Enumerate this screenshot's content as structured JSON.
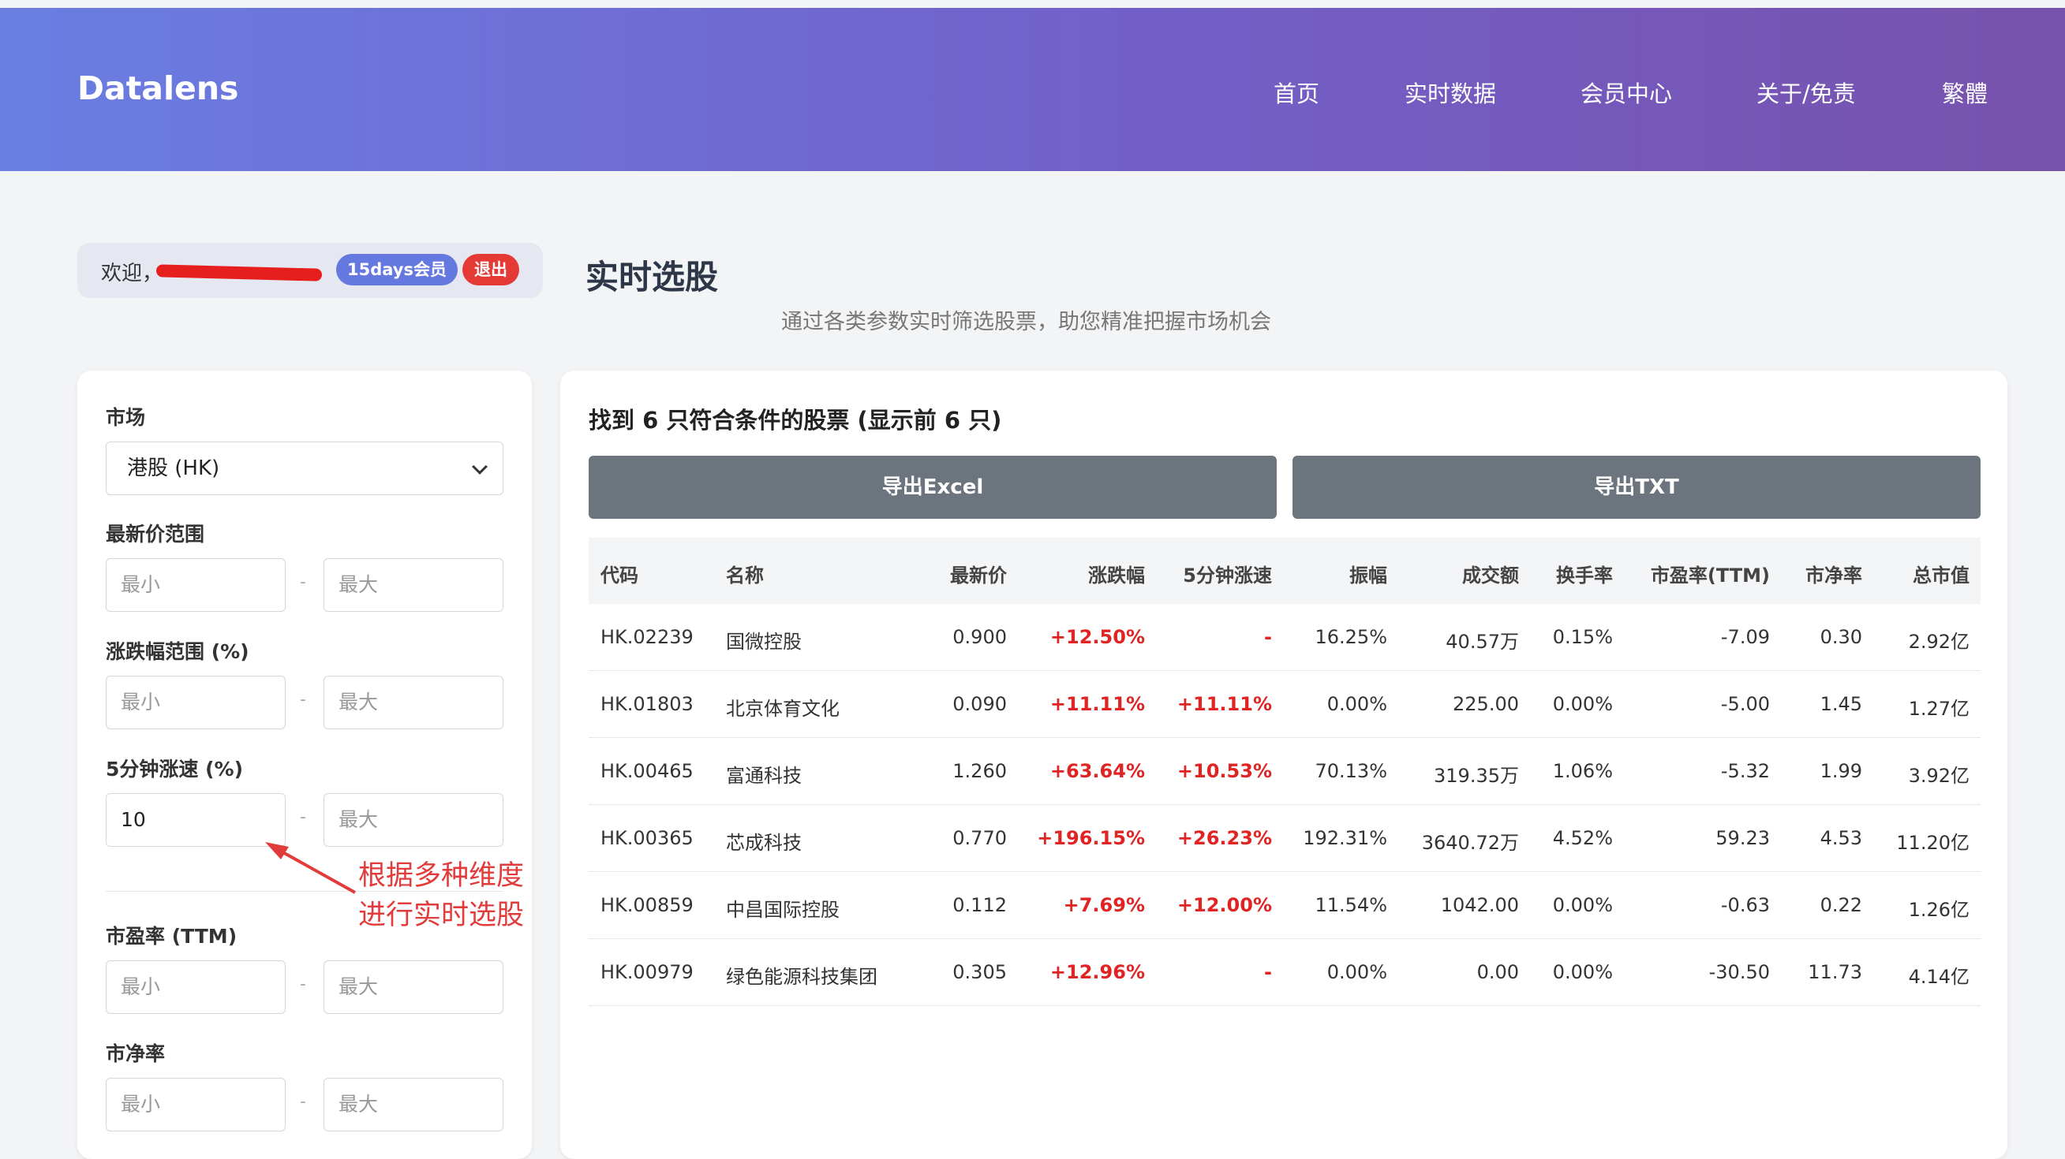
{
  "header": {
    "brand": "Datalens",
    "nav": [
      "首页",
      "实时数据",
      "会员中心",
      "关于/免责",
      "繁體"
    ]
  },
  "user": {
    "welcome": "欢迎，",
    "membership": "15days会员",
    "logout": "退出"
  },
  "page": {
    "title": "实时选股",
    "subtitle": "通过各类参数实时筛选股票，助您精准把握市场机会"
  },
  "filters": {
    "market_label": "市场",
    "market_value": "港股 (HK)",
    "price_label": "最新价范围",
    "change_label": "涨跌幅范围 (%)",
    "speed_label": "5分钟涨速 (%)",
    "speed_min_value": "10",
    "pe_label": "市盈率 (TTM)",
    "pb_label": "市净率",
    "min_placeholder": "最小",
    "max_placeholder": "最大",
    "separator": "-"
  },
  "annotation": [
    "根据多种维度",
    "进行实时选股"
  ],
  "results": {
    "title": "找到 6 只符合条件的股票 (显示前 6 只)",
    "export_excel": "导出Excel",
    "export_txt": "导出TXT",
    "columns": [
      "代码",
      "名称",
      "最新价",
      "涨跌幅",
      "5分钟涨速",
      "振幅",
      "成交额",
      "换手率",
      "市盈率(TTM)",
      "市净率",
      "总市值"
    ],
    "rows": [
      [
        "HK.02239",
        "国微控股",
        "0.900",
        "+12.50%",
        "-",
        "16.25%",
        "40.57万",
        "0.15%",
        "-7.09",
        "0.30",
        "2.92亿"
      ],
      [
        "HK.01803",
        "北京体育文化",
        "0.090",
        "+11.11%",
        "+11.11%",
        "0.00%",
        "225.00",
        "0.00%",
        "-5.00",
        "1.45",
        "1.27亿"
      ],
      [
        "HK.00465",
        "富通科技",
        "1.260",
        "+63.64%",
        "+10.53%",
        "70.13%",
        "319.35万",
        "1.06%",
        "-5.32",
        "1.99",
        "3.92亿"
      ],
      [
        "HK.00365",
        "芯成科技",
        "0.770",
        "+196.15%",
        "+26.23%",
        "192.31%",
        "3640.72万",
        "4.52%",
        "59.23",
        "4.53",
        "11.20亿"
      ],
      [
        "HK.00859",
        "中昌国际控股",
        "0.112",
        "+7.69%",
        "+12.00%",
        "11.54%",
        "1042.00",
        "0.00%",
        "-0.63",
        "0.22",
        "1.26亿"
      ],
      [
        "HK.00979",
        "绿色能源科技集团",
        "0.305",
        "+12.96%",
        "-",
        "0.00%",
        "0.00",
        "0.00%",
        "-30.50",
        "11.73",
        "4.14亿"
      ]
    ]
  },
  "colors": {
    "header_start": "#6a7ee2",
    "header_end": "#7752ad",
    "up": "#e02424",
    "button": "#6c757d",
    "member_badge": "#6478e0",
    "logout_badge": "#e53935"
  }
}
